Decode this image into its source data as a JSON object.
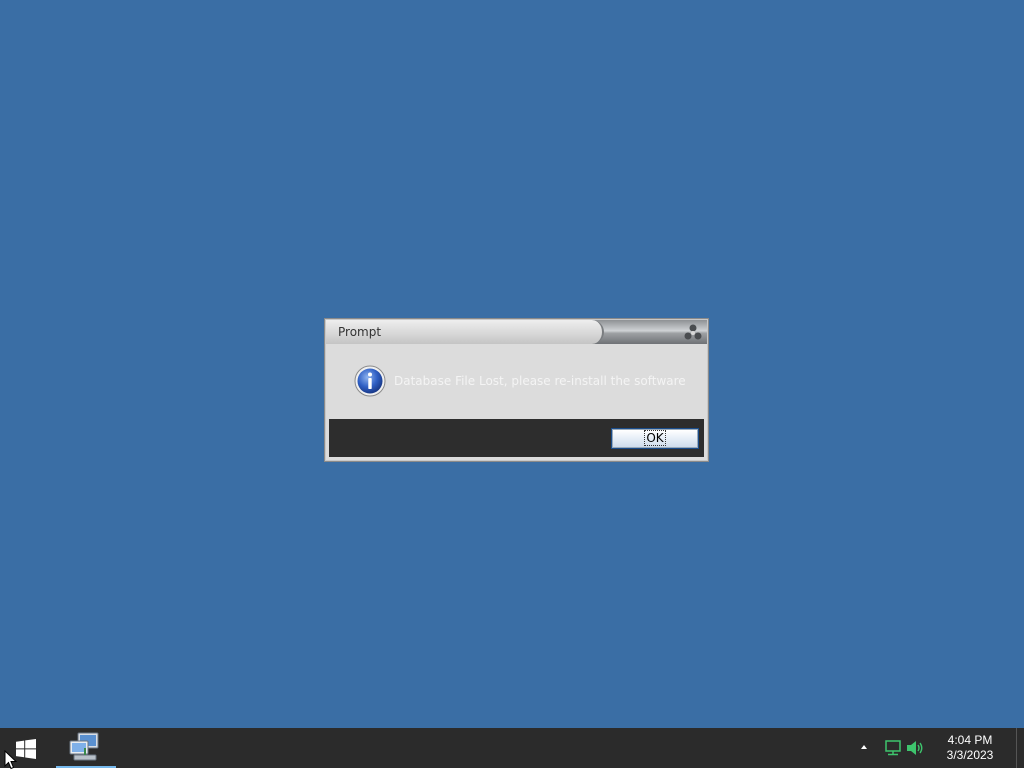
{
  "dialog": {
    "title": "Prompt",
    "message": "Database File Lost, please re-install the software",
    "ok_label": "OK",
    "icon": "info-icon"
  },
  "taskbar": {
    "start_icon": "windows-logo-icon",
    "app_icon": "network-computer-icon",
    "tray_icons": [
      "tray-overflow-arrow-icon",
      "network-icon",
      "volume-icon"
    ],
    "time": "4:04 PM",
    "date": "3/3/2023"
  },
  "colors": {
    "desktop": "#3a6ea5",
    "taskbar": "#2b2b2b",
    "dialog_body": "#dcdcdc",
    "dialog_footer": "#2d2d2d",
    "tray_icons": "#3ec46d"
  }
}
